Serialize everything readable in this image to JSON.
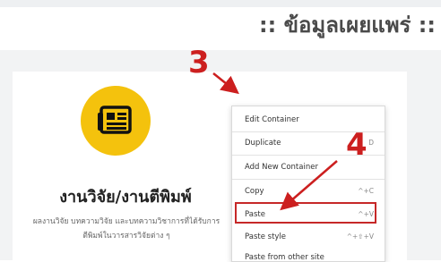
{
  "page": {
    "section_title": ":: ข้อมูลเผยแพร่ ::"
  },
  "card": {
    "icon": "newspaper-icon",
    "title": "งานวิจัย/งานตีพิมพ์",
    "description": "ผลงานวิจัย บทความวิจัย และบทความวิชาการที่ได้รับการตีพิมพ์ในวารสารวิจัยต่าง ๆ"
  },
  "annotations": {
    "step3": "3",
    "step4": "4"
  },
  "context_menu": {
    "items": [
      {
        "label": "Edit Container",
        "shortcut": ""
      },
      {
        "label": "Duplicate",
        "shortcut": "D"
      },
      {
        "label": "Add New Container",
        "shortcut": ""
      },
      {
        "label": "Copy",
        "shortcut": "^+C"
      },
      {
        "label": "Paste",
        "shortcut": "^+V"
      },
      {
        "label": "Paste style",
        "shortcut": "^+⇧+V"
      },
      {
        "label": "Paste from other site",
        "shortcut": ""
      }
    ]
  },
  "colors": {
    "accent_yellow": "#f4c20d",
    "annotation_red": "#cc1f1f"
  }
}
